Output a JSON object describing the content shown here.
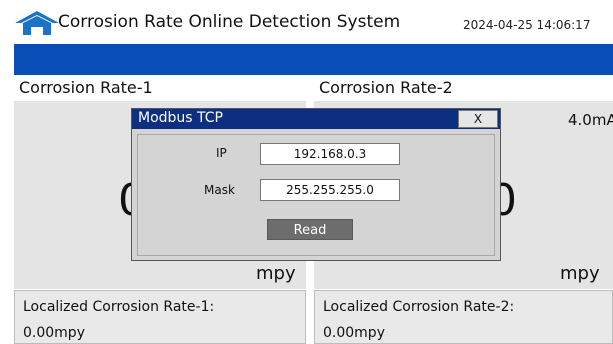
{
  "header": {
    "title": "Corrosion Rate Online Detection System",
    "datetime": "2024-04-25 14:06:17",
    "icon": "home-icon",
    "accent_color": "#0a4fb8"
  },
  "panels": [
    {
      "title": "Corrosion Rate-1",
      "value": "0",
      "unit": "mpy",
      "local_label": "Localized Corrosion Rate-1:",
      "local_value": "0.00mpy"
    },
    {
      "title": "Corrosion Rate-2",
      "value": "0",
      "unit": "mpy",
      "current": "4.0mA",
      "local_label": "Localized Corrosion Rate-2:",
      "local_value": "0.00mpy"
    }
  ],
  "dialog": {
    "title": "Modbus TCP",
    "close_label": "X",
    "ip_label": "IP",
    "ip_value": "192.168.0.3",
    "mask_label": "Mask",
    "mask_value": "255.255.255.0",
    "read_label": "Read",
    "titlebar_color": "#0c2f82"
  }
}
